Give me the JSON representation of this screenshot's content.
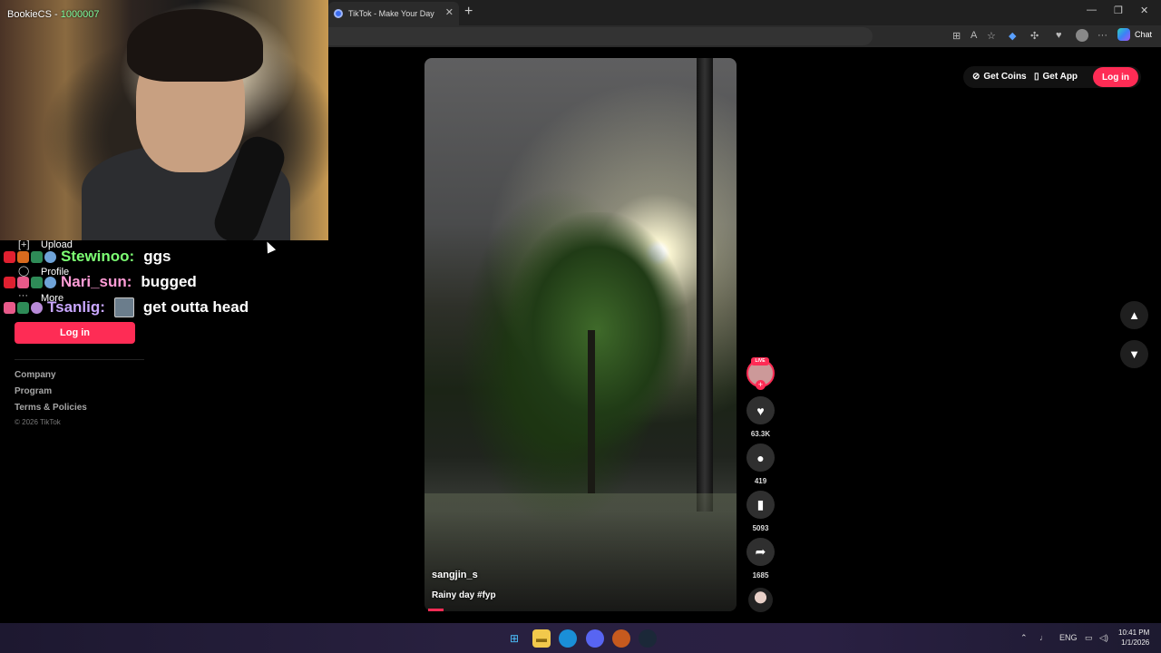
{
  "browser": {
    "tab_title": "TikTok - Make Your Day",
    "tab_close": "✕",
    "new_tab": "+",
    "minimize": "—",
    "maximize": "❐",
    "close": "✕",
    "chat_label": "Chat"
  },
  "stream": {
    "streamer": "BookieCS",
    "separator": " - ",
    "counter": "1000007"
  },
  "chat": [
    {
      "user": "Stewinoo:",
      "message": "ggs",
      "color": "#7dff74"
    },
    {
      "user": "Nari_sun:",
      "message": "bugged",
      "color": "#ff9cd6"
    },
    {
      "user": "Tsanlig:",
      "message": "get outta head",
      "color": "#c9a7ff"
    }
  ],
  "sidebar": {
    "items": [
      {
        "icon": "[+]",
        "label": "Upload"
      },
      {
        "icon": "◯",
        "label": "Profile"
      },
      {
        "icon": "···",
        "label": "More"
      }
    ],
    "login": "Log in",
    "footer": [
      "Company",
      "Program",
      "Terms & Policies"
    ],
    "copyright": "© 2026 TikTok"
  },
  "header": {
    "get_coins": "Get Coins",
    "get_app": "Get App",
    "login": "Log in"
  },
  "video": {
    "author": "sangjin_s",
    "caption": "Rainy day #fyp",
    "live_tag": "LIVE",
    "likes": "63.3K",
    "comments": "419",
    "saves": "5093",
    "shares": "1685",
    "progress": 0.05
  },
  "taskbar": {
    "lang": "ENG",
    "time": "10:41 PM",
    "date": "1/1/2026"
  }
}
